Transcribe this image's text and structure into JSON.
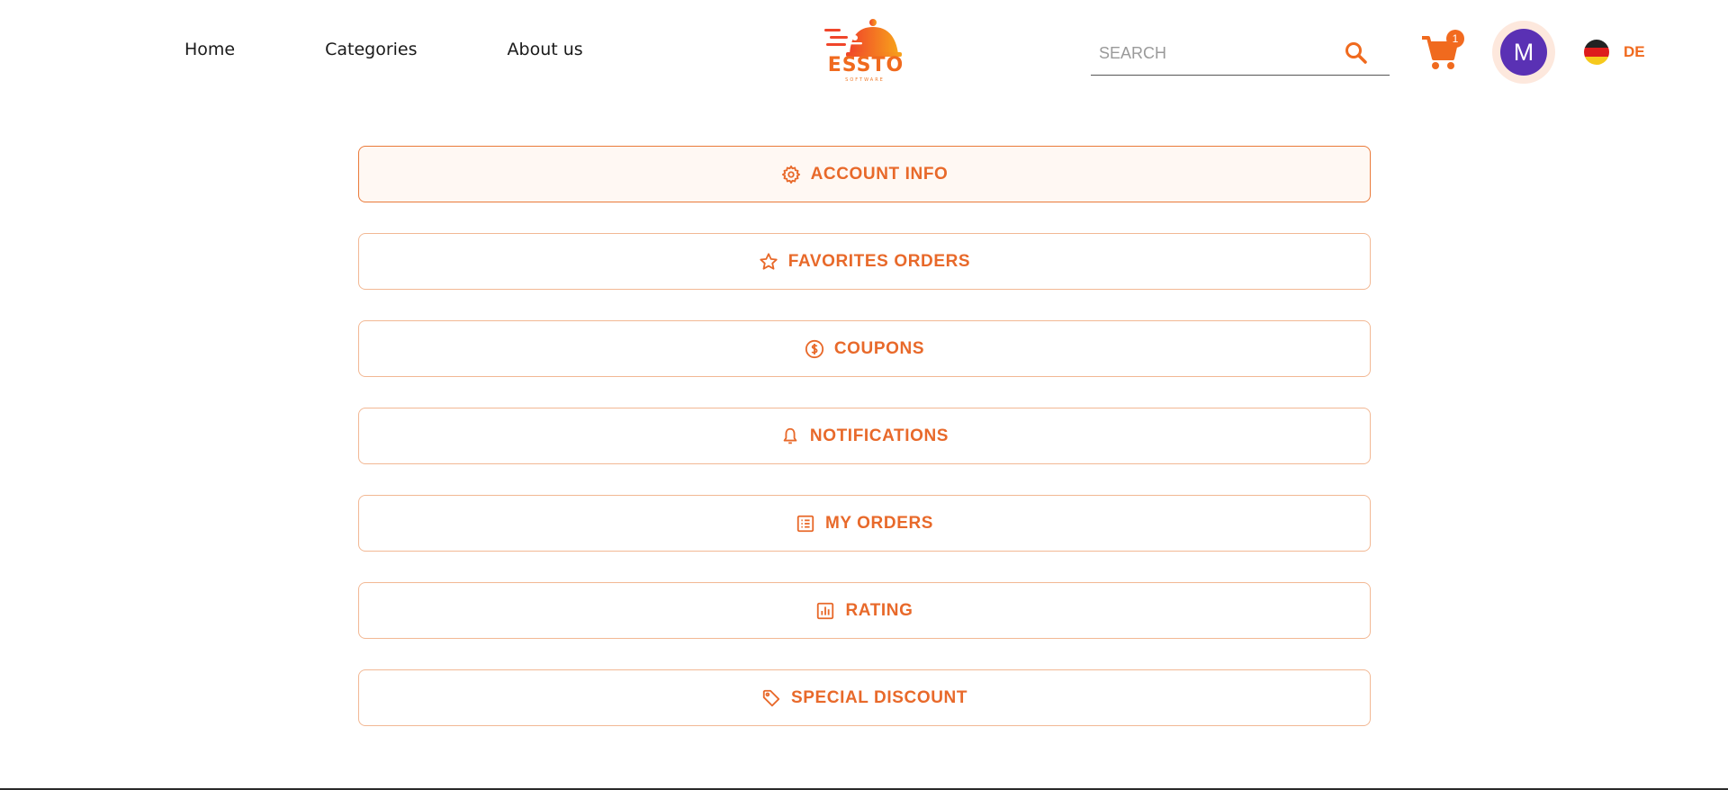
{
  "nav": {
    "items": [
      {
        "label": "Home"
      },
      {
        "label": "Categories"
      },
      {
        "label": "About us"
      }
    ]
  },
  "logo": {
    "text": "ESSTO",
    "subtext": "SOFTWARE",
    "icon": "cloche-icon",
    "brand_color": "#f06a1e"
  },
  "search": {
    "placeholder": "SEARCH",
    "value": "",
    "icon": "search-icon"
  },
  "cart": {
    "icon": "cart-icon",
    "count": "1"
  },
  "user": {
    "avatar_initial": "M",
    "avatar_color": "#5a31b4"
  },
  "language": {
    "code": "DE",
    "flag": "germany-flag-icon"
  },
  "menu": {
    "items": [
      {
        "label": "ACCOUNT INFO",
        "icon": "gear-icon",
        "active": true
      },
      {
        "label": "FAVORITES ORDERS",
        "icon": "star-icon",
        "active": false
      },
      {
        "label": "COUPONS",
        "icon": "dollar-coin-icon",
        "active": false
      },
      {
        "label": "NOTIFICATIONS",
        "icon": "bell-icon",
        "active": false
      },
      {
        "label": "MY ORDERS",
        "icon": "list-icon",
        "active": false
      },
      {
        "label": "RATING",
        "icon": "bar-chart-icon",
        "active": false
      },
      {
        "label": "SPECIAL DISCOUNT",
        "icon": "tag-icon",
        "active": false
      }
    ]
  },
  "colors": {
    "accent": "#e8692a",
    "border": "#f2b894"
  }
}
